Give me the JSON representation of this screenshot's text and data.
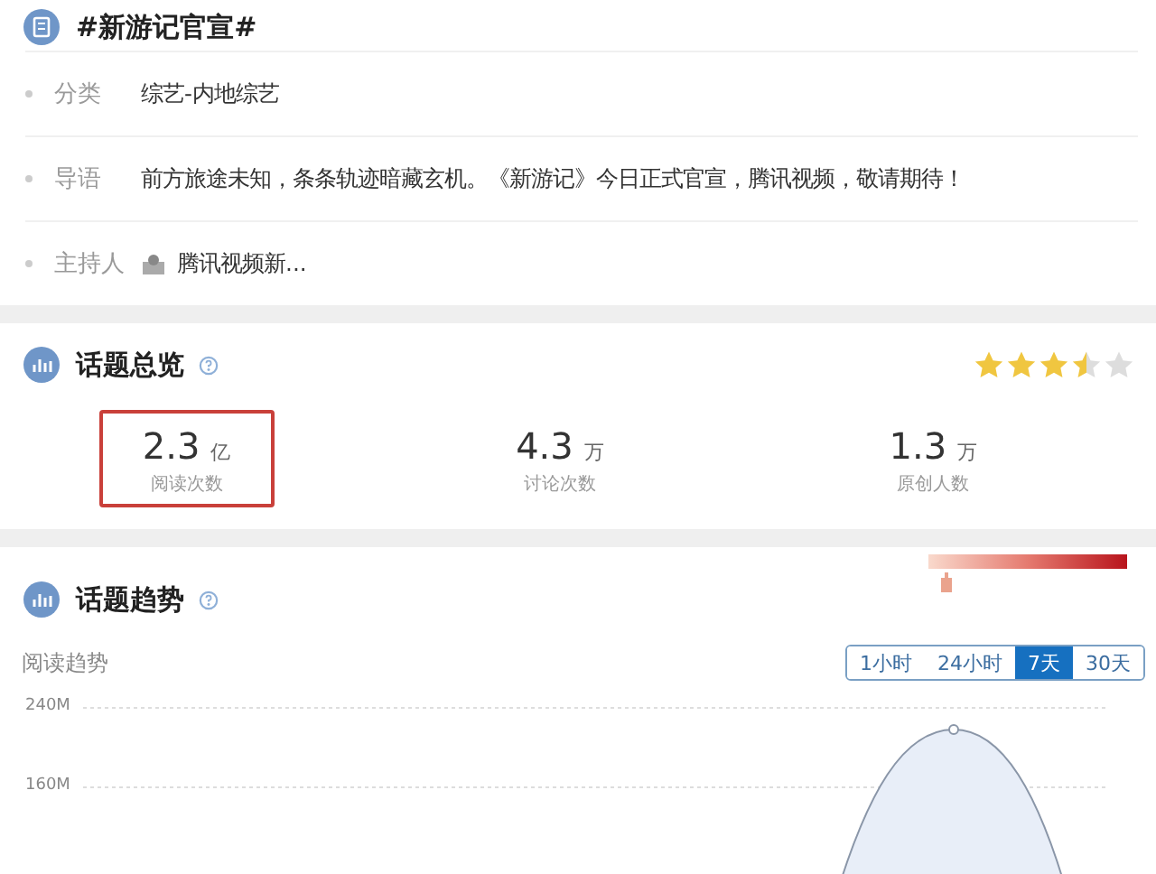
{
  "topic": {
    "title": "#新游记官宣#",
    "rows": [
      {
        "label": "分类",
        "value": "综艺-内地综艺",
        "kind": "text"
      },
      {
        "label": "导语",
        "value": "前方旅途未知，条条轨迹暗藏玄机。《新游记》今日正式官宣，腾讯视频，敬请期待！",
        "kind": "text"
      },
      {
        "label": "主持人",
        "value": "腾讯视频新...",
        "kind": "host"
      }
    ]
  },
  "overview": {
    "title": "话题总览",
    "stars": 3.5,
    "stats": [
      {
        "number": "2.3",
        "unit": "亿",
        "label": "阅读次数",
        "selected": true
      },
      {
        "number": "4.3",
        "unit": "万",
        "label": "讨论次数",
        "selected": false
      },
      {
        "number": "1.3",
        "unit": "万",
        "label": "原创人数",
        "selected": false
      }
    ]
  },
  "trend": {
    "title": "话题趋势",
    "heat": {
      "level": 0.05
    },
    "subtitle": "阅读趋势",
    "ranges": [
      {
        "label": "1小时",
        "selected": false
      },
      {
        "label": "24小时",
        "selected": false
      },
      {
        "label": "7天",
        "selected": true
      },
      {
        "label": "30天",
        "selected": false
      }
    ],
    "y_tick_labels": [
      "240M",
      "160M"
    ]
  }
}
